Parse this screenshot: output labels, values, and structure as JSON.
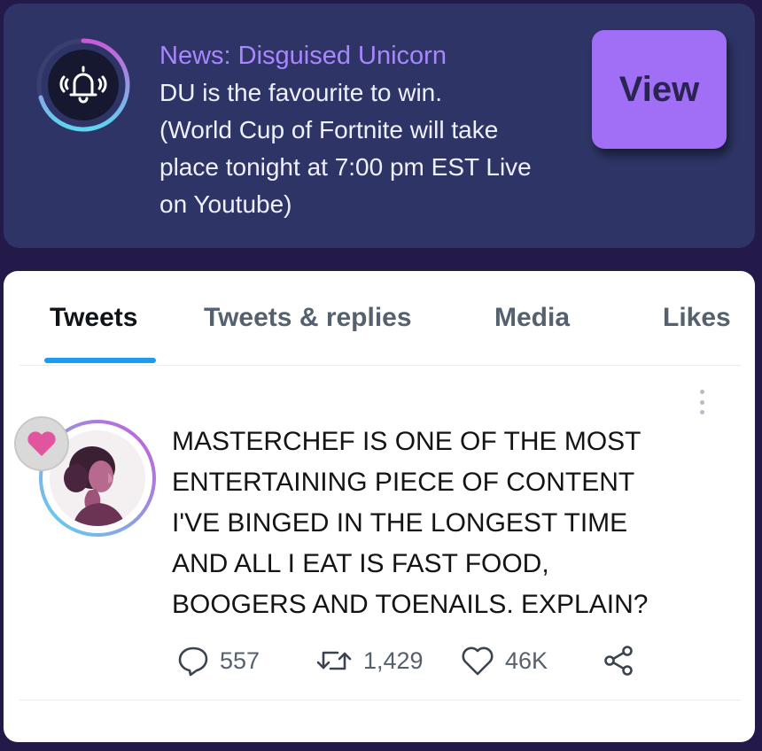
{
  "notification": {
    "icon": "bell-ringing-icon",
    "title": "News: Disguised Unicorn",
    "body_lines": [
      "DU is the favourite to win.",
      "(World Cup of Fortnite will take",
      "place tonight at 7:00 pm EST Live",
      "on Youtube)"
    ],
    "view_label": "View",
    "colors": {
      "card": "#2e3566",
      "title": "#a986ff",
      "button": "#a06ff5",
      "ring": [
        "#c85bd6",
        "#5dd6f0"
      ]
    }
  },
  "tabs": [
    {
      "label": "Tweets",
      "active": true
    },
    {
      "label": "Tweets & replies",
      "active": false
    },
    {
      "label": "Media",
      "active": false
    },
    {
      "label": "Likes",
      "active": false
    }
  ],
  "tweet": {
    "avatar": "woman-portrait-avatar",
    "badge_icon": "heart-icon",
    "more_icon": "vertical-ellipsis-icon",
    "text_lines": [
      "MASTERCHEF IS ONE OF THE MOST",
      "ENTERTAINING PIECE OF CONTENT",
      "I'VE BINGED IN THE LONGEST TIME",
      "AND ALL I EAT IS FAST FOOD,",
      "BOOGERS AND TOENAILS. EXPLAIN?"
    ],
    "actions": {
      "reply": {
        "icon": "reply-icon",
        "count": "557"
      },
      "retweet": {
        "icon": "retweet-icon",
        "count": "1,429"
      },
      "like": {
        "icon": "heart-outline-icon",
        "count": "46K"
      },
      "share": {
        "icon": "share-icon"
      }
    }
  }
}
